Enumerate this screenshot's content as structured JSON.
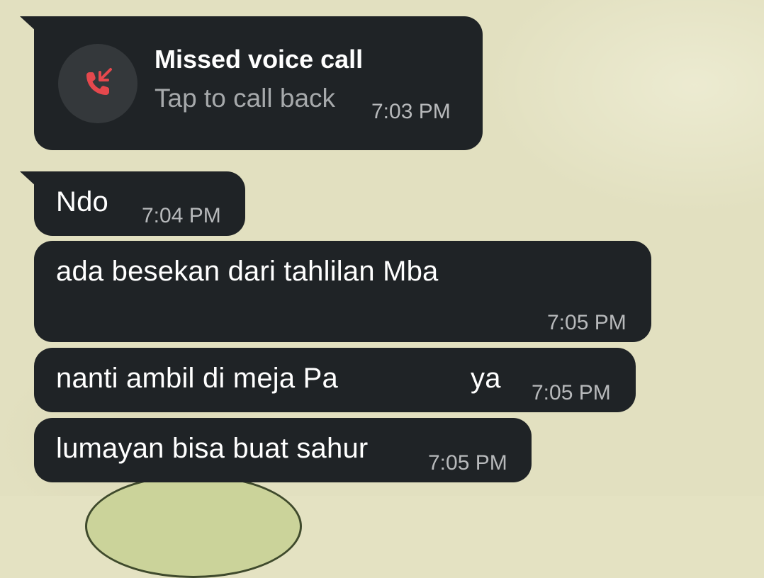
{
  "call": {
    "title": "Missed voice call",
    "subtitle": "Tap to call back",
    "time": "7:03 PM",
    "icon": "missed-call-icon",
    "icon_color": "#e5484d"
  },
  "messages": [
    {
      "text": "Ndo",
      "time": "7:04 PM"
    },
    {
      "text": "ada besekan dari tahlilan Mba",
      "time": "7:05 PM"
    },
    {
      "text": "nanti ambil di meja Pa",
      "text_after_redaction": "ya",
      "time": "7:05 PM"
    },
    {
      "text": "lumayan bisa buat sahur",
      "time": "7:05 PM"
    }
  ],
  "colors": {
    "bubble": "#1f2326",
    "wallpaper": "#e2e0c0",
    "timestamp": "#b7b9bb",
    "missed_call_red": "#e5484d"
  }
}
